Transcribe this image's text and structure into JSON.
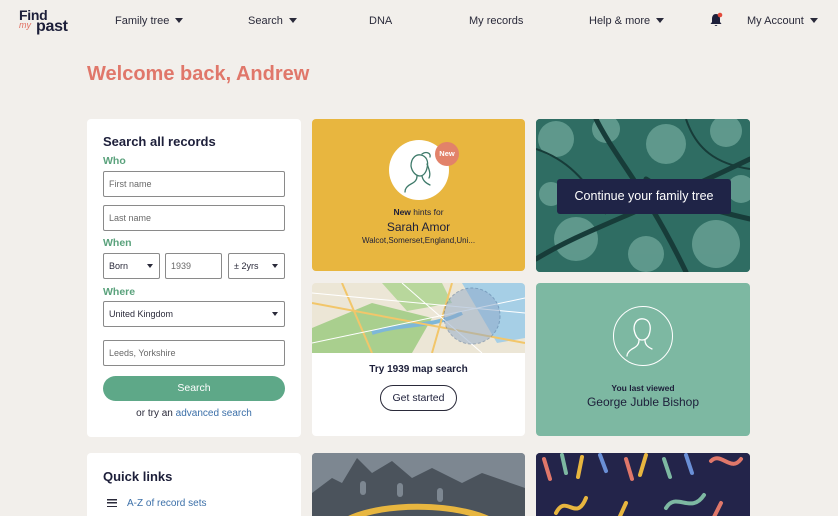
{
  "brand": {
    "line1": "Find",
    "line2": "my",
    "line3": "past"
  },
  "nav": {
    "family_tree": "Family tree",
    "search": "Search",
    "dna": "DNA",
    "my_records": "My records",
    "help": "Help & more",
    "account": "My Account"
  },
  "welcome": "Welcome back, Andrew",
  "search_card": {
    "title": "Search all records",
    "who_label": "Who",
    "first_name_placeholder": "First name",
    "last_name_placeholder": "Last name",
    "when_label": "When",
    "event_value": "Born",
    "year_placeholder": "1939",
    "range_value": "± 2yrs",
    "where_label": "Where",
    "country_value": "United Kingdom",
    "place_placeholder": "Leeds, Yorkshire",
    "search_button": "Search",
    "advanced_prefix": "or try an",
    "advanced_link": "advanced search"
  },
  "quick_links": {
    "title": "Quick links",
    "items": [
      "A-Z of record sets"
    ]
  },
  "hints": {
    "badge": "New",
    "line_bold": "New",
    "line_rest": "hints for",
    "name": "Sarah Amor",
    "place": "Walcot,Somerset,England,Uni..."
  },
  "continue": {
    "button": "Continue your family tree"
  },
  "map": {
    "title": "Try 1939 map search",
    "button": "Get started"
  },
  "viewed": {
    "label": "You last viewed",
    "name": "George Juble Bishop"
  },
  "colors": {
    "accent_coral": "#e0776a",
    "green": "#5ea888",
    "yellow": "#e8b63f",
    "teal": "#7db8a2",
    "navy": "#1f2447"
  }
}
